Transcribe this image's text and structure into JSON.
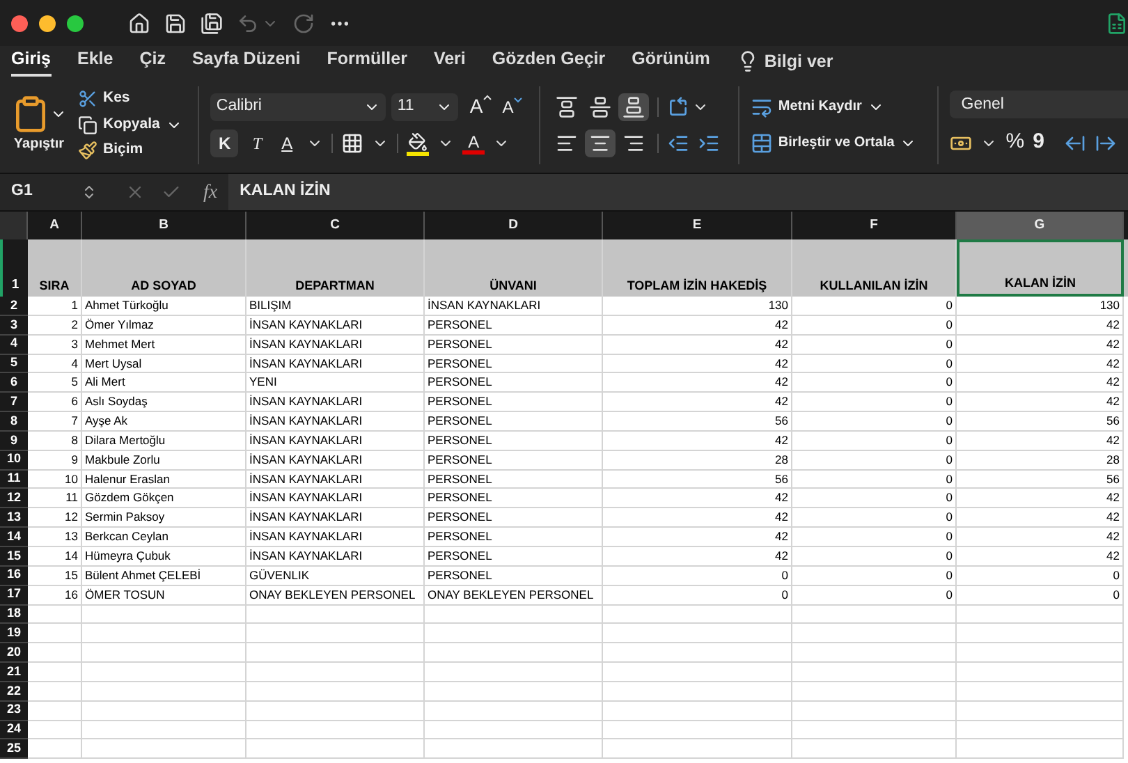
{
  "tabs": [
    {
      "label": "Giriş",
      "selected": true
    },
    {
      "label": "Ekle",
      "selected": false
    },
    {
      "label": "Çiz",
      "selected": false
    },
    {
      "label": "Sayfa Düzeni",
      "selected": false
    },
    {
      "label": "Formüller",
      "selected": false
    },
    {
      "label": "Veri",
      "selected": false
    },
    {
      "label": "Gözden Geçir",
      "selected": false
    },
    {
      "label": "Görünüm",
      "selected": false
    }
  ],
  "tell_me": "Bilgi ver",
  "clipboard": {
    "paste": "Yapıştır",
    "cut": "Kes",
    "copy": "Kopyala",
    "format_painter": "Biçim"
  },
  "font": {
    "name": "Calibri",
    "size": "11",
    "grow": "A",
    "shrink": "A",
    "bold": "K",
    "italic": "T",
    "underline": "A",
    "font_color": "A"
  },
  "vertical_align": [
    {
      "kind": "top",
      "selected": false
    },
    {
      "kind": "middle",
      "selected": false
    },
    {
      "kind": "bottom",
      "selected": true
    }
  ],
  "horizontal_align": [
    {
      "kind": "left",
      "selected": false
    },
    {
      "kind": "center",
      "selected": true
    },
    {
      "kind": "right",
      "selected": false
    }
  ],
  "wrap_text": "Metni Kaydır",
  "merge_center": "Birleştir ve Ortala",
  "number_format": "Genel",
  "percent": "%",
  "comma": "9",
  "name_box": "G1",
  "fx": "fx",
  "formula": "KALAN İZİN",
  "columns": [
    {
      "letter": "A",
      "kind": "number",
      "selected": false
    },
    {
      "letter": "B",
      "kind": "text",
      "selected": false
    },
    {
      "letter": "C",
      "kind": "text",
      "selected": false
    },
    {
      "letter": "D",
      "kind": "text",
      "selected": false
    },
    {
      "letter": "E",
      "kind": "number",
      "selected": false
    },
    {
      "letter": "F",
      "kind": "number",
      "selected": false
    },
    {
      "letter": "G",
      "kind": "number",
      "selected": true
    }
  ],
  "header_row": {
    "number": "1",
    "cells": [
      {
        "text": "SIRA",
        "selected": false
      },
      {
        "text": "AD SOYAD",
        "selected": false
      },
      {
        "text": "DEPARTMAN",
        "selected": false
      },
      {
        "text": "ÜNVANI",
        "selected": false
      },
      {
        "text": "TOPLAM İZİN HAKEDİŞ",
        "selected": false
      },
      {
        "text": "KULLANILAN İZİN",
        "selected": false
      },
      {
        "text": "KALAN İZİN",
        "selected": true
      }
    ]
  },
  "rows": [
    {
      "number": "2",
      "cells": [
        "1",
        "Ahmet Türkoğlu",
        "BILIŞIM",
        "İNSAN KAYNAKLARI",
        "130",
        "0",
        "130"
      ]
    },
    {
      "number": "3",
      "cells": [
        "2",
        "Ömer Yılmaz",
        "İNSAN KAYNAKLARI",
        "PERSONEL",
        "42",
        "0",
        "42"
      ]
    },
    {
      "number": "4",
      "cells": [
        "3",
        "Mehmet Mert",
        "İNSAN KAYNAKLARI",
        "PERSONEL",
        "42",
        "0",
        "42"
      ]
    },
    {
      "number": "5",
      "cells": [
        "4",
        "Mert Uysal",
        "İNSAN KAYNAKLARI",
        "PERSONEL",
        "42",
        "0",
        "42"
      ]
    },
    {
      "number": "6",
      "cells": [
        "5",
        "Ali Mert",
        "YENI",
        "PERSONEL",
        "42",
        "0",
        "42"
      ]
    },
    {
      "number": "7",
      "cells": [
        "6",
        "Aslı Soydaş",
        "İNSAN KAYNAKLARI",
        "PERSONEL",
        "42",
        "0",
        "42"
      ]
    },
    {
      "number": "8",
      "cells": [
        "7",
        "Ayşe Ak",
        "İNSAN KAYNAKLARI",
        "PERSONEL",
        "56",
        "0",
        "56"
      ]
    },
    {
      "number": "9",
      "cells": [
        "8",
        "Dilara Mertoğlu",
        "İNSAN KAYNAKLARI",
        "PERSONEL",
        "42",
        "0",
        "42"
      ]
    },
    {
      "number": "10",
      "cells": [
        "9",
        "Makbule Zorlu",
        "İNSAN KAYNAKLARI",
        "PERSONEL",
        "28",
        "0",
        "28"
      ]
    },
    {
      "number": "11",
      "cells": [
        "10",
        "Halenur Eraslan",
        "İNSAN KAYNAKLARI",
        "PERSONEL",
        "56",
        "0",
        "56"
      ]
    },
    {
      "number": "12",
      "cells": [
        "11",
        "Gözdem Gökçen",
        "İNSAN KAYNAKLARI",
        "PERSONEL",
        "42",
        "0",
        "42"
      ]
    },
    {
      "number": "13",
      "cells": [
        "12",
        "Sermin Paksoy",
        "İNSAN KAYNAKLARI",
        "PERSONEL",
        "42",
        "0",
        "42"
      ]
    },
    {
      "number": "14",
      "cells": [
        "13",
        "Berkcan Ceylan",
        "İNSAN KAYNAKLARI",
        "PERSONEL",
        "42",
        "0",
        "42"
      ]
    },
    {
      "number": "15",
      "cells": [
        "14",
        "Hümeyra Çubuk",
        "İNSAN KAYNAKLARI",
        "PERSONEL",
        "42",
        "0",
        "42"
      ]
    },
    {
      "number": "16",
      "cells": [
        "15",
        "Bülent Ahmet ÇELEBİ",
        "GÜVENLIK",
        "PERSONEL",
        "0",
        "0",
        "0"
      ]
    },
    {
      "number": "17",
      "cells": [
        "16",
        "ÖMER TOSUN",
        "ONAY BEKLEYEN PERSONEL",
        "ONAY BEKLEYEN PERSONEL",
        "0",
        "0",
        "0"
      ]
    },
    {
      "number": "18"
    },
    {
      "number": "19"
    },
    {
      "number": "20"
    },
    {
      "number": "21"
    },
    {
      "number": "22"
    },
    {
      "number": "23"
    },
    {
      "number": "24"
    },
    {
      "number": "25"
    }
  ]
}
